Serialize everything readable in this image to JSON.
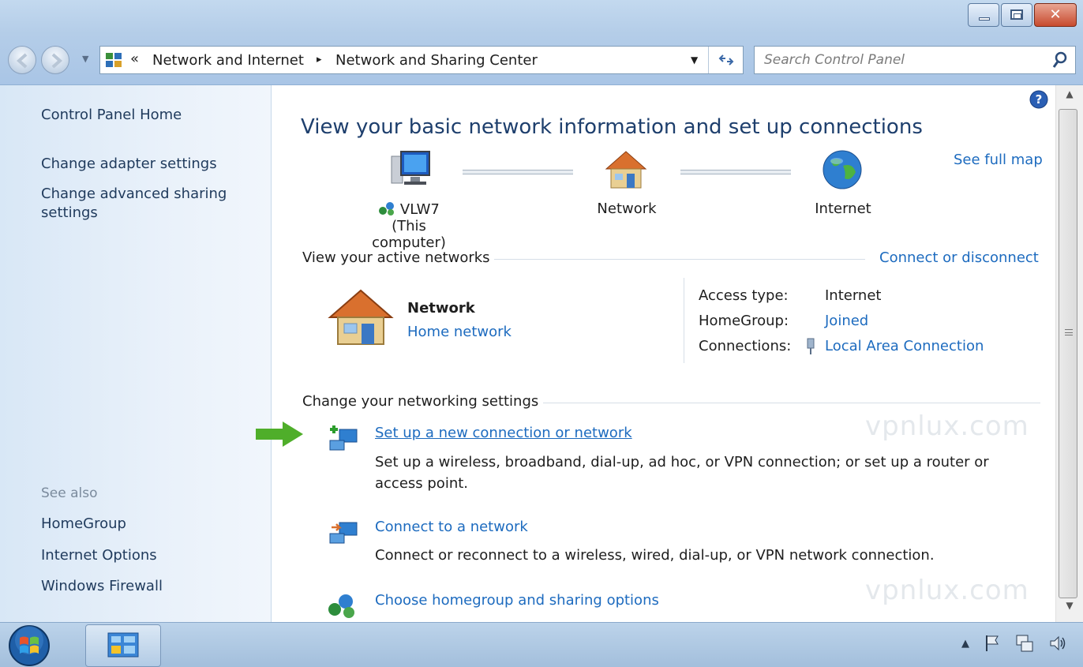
{
  "address_bar": {
    "overflow_chevron": "«",
    "crumb_parent": "Network and Internet",
    "crumb_separator": "▸",
    "crumb_current": "Network and Sharing Center"
  },
  "search": {
    "placeholder": "Search Control Panel"
  },
  "sidebar": {
    "home_link": "Control Panel Home",
    "links": [
      "Change adapter settings",
      "Change advanced sharing settings"
    ],
    "see_also_heading": "See also",
    "see_also": [
      "HomeGroup",
      "Internet Options",
      "Windows Firewall"
    ]
  },
  "main": {
    "title": "View your basic network information and set up connections",
    "see_full_map": "See full map",
    "map": {
      "computer_name": "VLW7",
      "computer_sub": "(This computer)",
      "network_label": "Network",
      "internet_label": "Internet"
    },
    "active_networks": {
      "heading": "View your active networks",
      "connect_link": "Connect or disconnect",
      "network_name": "Network",
      "network_type": "Home network",
      "access_type_label": "Access type:",
      "access_type_value": "Internet",
      "homegroup_label": "HomeGroup:",
      "homegroup_value": "Joined",
      "connections_label": "Connections:",
      "connections_value": "Local Area Connection"
    },
    "change_settings": {
      "heading": "Change your networking settings",
      "tasks": [
        {
          "title": "Set up a new connection or network",
          "desc": "Set up a wireless, broadband, dial-up, ad hoc, or VPN connection; or set up a router or access point."
        },
        {
          "title": "Connect to a network",
          "desc": "Connect or reconnect to a wireless, wired, dial-up, or VPN network connection."
        },
        {
          "title": "Choose homegroup and sharing options",
          "desc": ""
        }
      ]
    },
    "watermark": "vpnlux.com"
  },
  "colors": {
    "link": "#1d6bbf",
    "title": "#1e3f6d",
    "arrow_green": "#4fae2a"
  }
}
